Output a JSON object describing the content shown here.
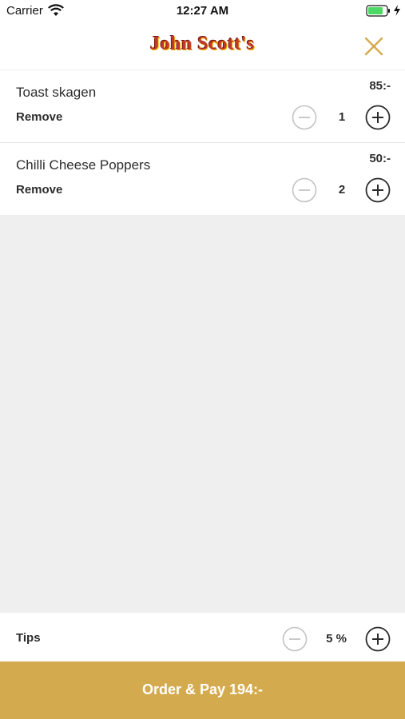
{
  "status_bar": {
    "carrier": "Carrier",
    "time": "12:27 AM"
  },
  "header": {
    "logo_text": "John Scott's",
    "close_icon": "close-icon",
    "accent_color": "#d4aa4e"
  },
  "cart": {
    "items": [
      {
        "name": "Toast skagen",
        "price": "85:-",
        "remove_label": "Remove",
        "quantity": "1"
      },
      {
        "name": "Chilli Cheese Poppers",
        "price": "50:-",
        "remove_label": "Remove",
        "quantity": "2"
      }
    ]
  },
  "tips": {
    "label": "Tips",
    "value": "5 %"
  },
  "checkout": {
    "button_label": "Order & Pay 194:-"
  },
  "icons": {
    "minus": "minus-circle-icon",
    "plus": "plus-circle-icon"
  },
  "colors": {
    "button_bg": "#d4aa4e",
    "minus_disabled": "#c4c4c4",
    "plus_active": "#2b2b2b",
    "battery_green": "#4cd964"
  }
}
